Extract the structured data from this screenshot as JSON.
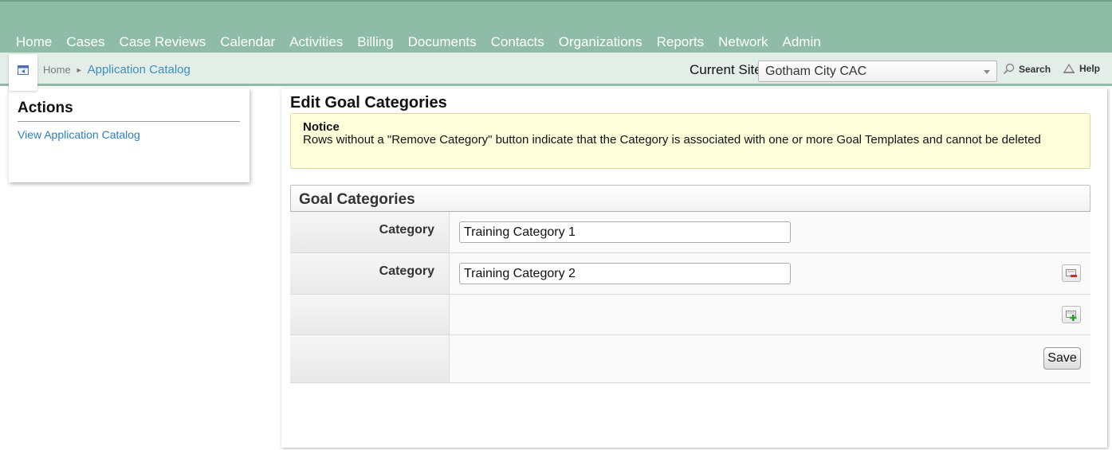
{
  "nav": {
    "items": [
      "Home",
      "Cases",
      "Case Reviews",
      "Calendar",
      "Activities",
      "Billing",
      "Documents",
      "Contacts",
      "Organizations",
      "Reports",
      "Network",
      "Admin"
    ]
  },
  "breadcrumb": {
    "home": "Home",
    "current": "Application Catalog"
  },
  "site": {
    "label": "Current Site",
    "selected": "Gotham City CAC"
  },
  "toolbar": {
    "search_label": "Search",
    "help_label": "Help"
  },
  "actions": {
    "title": "Actions",
    "links": [
      "View Application Catalog"
    ]
  },
  "main": {
    "title": "Edit Goal Categories",
    "notice": {
      "title": "Notice",
      "text": "Rows without a \"Remove Category\" button indicate that the Category is associated with one or more Goal Templates and cannot be deleted"
    },
    "section_title": "Goal Categories",
    "rows": [
      {
        "label": "Category",
        "value": "Training Category 1",
        "removable": false
      },
      {
        "label": "Category",
        "value": "Training Category 2",
        "removable": true
      }
    ],
    "save_label": "Save"
  },
  "colors": {
    "nav_bg": "#8ebca6",
    "subbar_bg": "#e4eee9",
    "link": "#2c7fb8",
    "notice_bg": "#ffffdc"
  },
  "icons": {
    "collapse": "panel-collapse-icon",
    "search": "magnifier-icon",
    "help": "help-icon",
    "remove": "remove-row-icon",
    "add": "add-row-icon"
  }
}
